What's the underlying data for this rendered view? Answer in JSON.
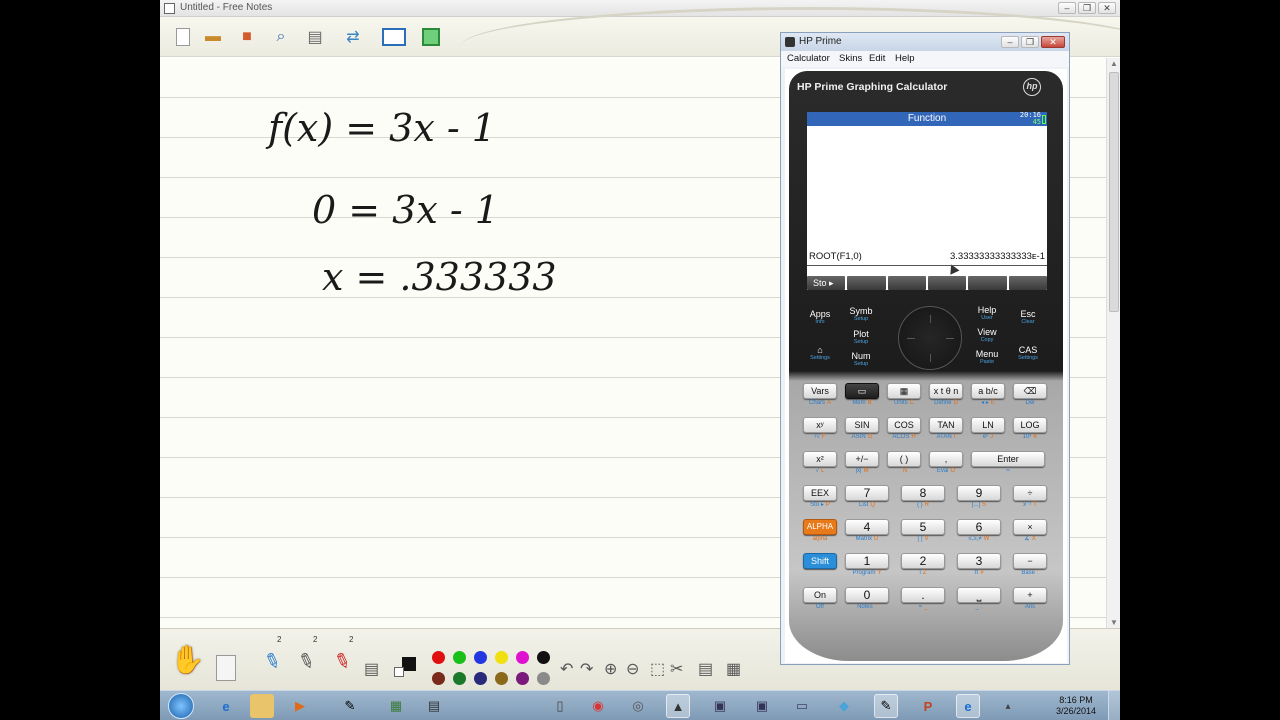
{
  "free_notes": {
    "title": "Untitled - Free Notes",
    "window_buttons": [
      "‒",
      "❐",
      "✕"
    ],
    "handwriting": {
      "line1": "f(x) = 3x - 1",
      "line2": "0 = 3x - 1",
      "line3": "x = .333333"
    },
    "pen_sizes": [
      "2",
      "2",
      "2"
    ],
    "palette_row1": [
      "#e01010",
      "#19c019",
      "#2237e0",
      "#f0e010",
      "#e010d0",
      "#101010"
    ],
    "palette_row2": [
      "#7a2a1a",
      "#1a7a2a",
      "#2a2a7a",
      "#8a6a1a",
      "#7a1a7a",
      "#8a8a8a"
    ]
  },
  "hp_prime": {
    "window_title": "HP Prime",
    "menu": [
      "Calculator",
      "Skins",
      "Edit",
      "Help"
    ],
    "brand": "HP Prime Graphing Calculator",
    "logo": "hp",
    "screen": {
      "header": "Function",
      "time_top": "20:16",
      "time_bottom": "45",
      "expression": "ROOT(F1,0)",
      "result": "3.33333333333333ᴇ-1",
      "softkey": "Sto ▸"
    },
    "controls": {
      "apps": {
        "main": "Apps",
        "sub": "Info"
      },
      "home": {
        "main": "⌂",
        "sub": "Settings"
      },
      "symb": {
        "main": "Symb",
        "sub": "Setup"
      },
      "plot": {
        "main": "Plot",
        "sub": "Setup"
      },
      "num": {
        "main": "Num",
        "sub": "Setup"
      },
      "help": {
        "main": "Help",
        "sub": "User"
      },
      "view": {
        "main": "View",
        "sub": "Copy"
      },
      "menu": {
        "main": "Menu",
        "sub": "Paste"
      },
      "esc": {
        "main": "Esc",
        "sub": "Clear"
      },
      "cas": {
        "main": "CAS",
        "sub": "Settings"
      }
    },
    "keys": {
      "r1": [
        {
          "cap": "Vars",
          "s": "Chars",
          "a": "A"
        },
        {
          "cap": "▭",
          "s": "Mem",
          "a": "B"
        },
        {
          "cap": "▦",
          "s": "Units",
          "a": "C"
        },
        {
          "cap": "x t θ n",
          "s": "Define",
          "a": "D"
        },
        {
          "cap": "a b/c",
          "s": "◂ ▸",
          "a": "E"
        },
        {
          "cap": "⌫",
          "s": "Del",
          "a": ""
        }
      ],
      "r2": [
        {
          "cap": "xʸ",
          "s": "ʸ√",
          "a": "F"
        },
        {
          "cap": "SIN",
          "s": "ASIN",
          "a": "G"
        },
        {
          "cap": "COS",
          "s": "ACOS",
          "a": "H"
        },
        {
          "cap": "TAN",
          "s": "ATAN",
          "a": "I"
        },
        {
          "cap": "LN",
          "s": "eˣ",
          "a": "J"
        },
        {
          "cap": "LOG",
          "s": "10ˣ",
          "a": "K"
        }
      ],
      "r3": [
        {
          "cap": "x²",
          "s": "√",
          "a": "L"
        },
        {
          "cap": "+/−",
          "s": "|x|",
          "a": "M"
        },
        {
          "cap": "( )",
          "s": "",
          "a": "N"
        },
        {
          "cap": ",",
          "s": "Eval",
          "a": "O"
        },
        {
          "cap": "Enter",
          "s": "≈",
          "a": ""
        }
      ],
      "r4": [
        {
          "cap": "EEX",
          "s": "Sto ▸",
          "a": "P"
        },
        {
          "cap": "7",
          "s": "List",
          "a": "Q"
        },
        {
          "cap": "8",
          "s": "{ }",
          "a": "R"
        },
        {
          "cap": "9",
          "s": "[...]",
          "a": "S"
        },
        {
          "cap": "÷",
          "s": "x⁻¹",
          "a": "T"
        }
      ],
      "r5": [
        {
          "cap": "ALPHA",
          "s": "alpha",
          "a": ""
        },
        {
          "cap": "4",
          "s": "Matrix",
          "a": "U"
        },
        {
          "cap": "5",
          "s": "[ ]",
          "a": "V"
        },
        {
          "cap": "6",
          "s": "≤,≥,≠",
          "a": "W"
        },
        {
          "cap": "×",
          "s": "∡",
          "a": "X"
        }
      ],
      "r6": [
        {
          "cap": "Shift",
          "s": "",
          "a": ""
        },
        {
          "cap": "1",
          "s": "Program",
          "a": "Y"
        },
        {
          "cap": "2",
          "s": "i",
          "a": "Z"
        },
        {
          "cap": "3",
          "s": "π",
          "a": "#"
        },
        {
          "cap": "−",
          "s": "Base",
          "a": ":"
        }
      ],
      "r7": [
        {
          "cap": "On",
          "s": "Off",
          "a": ""
        },
        {
          "cap": "0",
          "s": "Notes",
          "a": "\""
        },
        {
          "cap": ".",
          "s": "=",
          "a": "_"
        },
        {
          "cap": "⎵",
          "s": "_",
          "a": ";"
        },
        {
          "cap": "+",
          "s": "Ans",
          "a": ""
        }
      ]
    }
  },
  "taskbar": {
    "clock_time": "8:16 PM",
    "clock_date": "3/26/2014"
  }
}
